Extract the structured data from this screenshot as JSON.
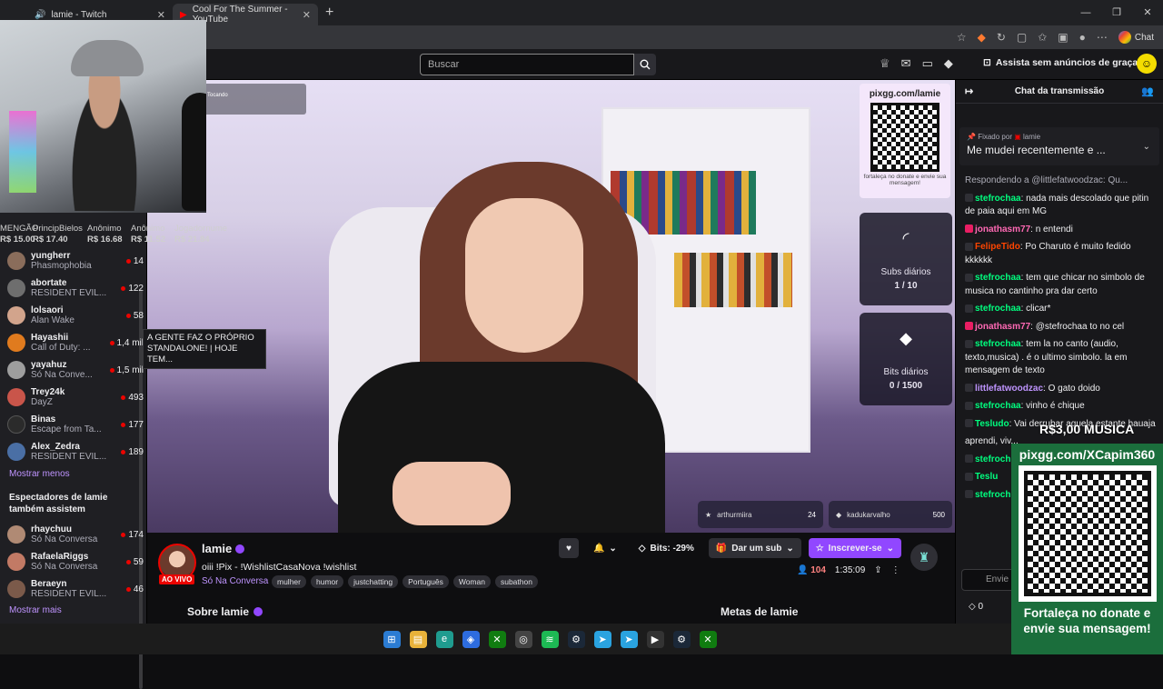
{
  "browser": {
    "tabs": [
      {
        "label": "lamie - Twitch",
        "active": true
      },
      {
        "label": "Cool For The Summer - YouTube",
        "active": false
      }
    ],
    "new_tab": "+",
    "chat_button": "Chat"
  },
  "nav": {
    "search_placeholder": "Buscar",
    "adfree_label": "Assista sem anúncios de graça"
  },
  "webcam_label": "Tocando",
  "donors": [
    {
      "name": "MENGÃO",
      "value": "R$ 15.00"
    },
    {
      "name": "PrincipBielos",
      "value": "R$ 17.40"
    },
    {
      "name": "Anônimo",
      "value": "R$ 16.68"
    },
    {
      "name": "Anônimo",
      "value": "R$ 11.52"
    },
    {
      "name": "Jogadornume",
      "value": "R$ 21.84"
    }
  ],
  "sidebar": {
    "channels": [
      {
        "name": "yungherr",
        "game": "Phasmophobia",
        "viewers": "14",
        "color": "#8a6d5b"
      },
      {
        "name": "abortate",
        "game": "RESIDENT EVIL...",
        "viewers": "122",
        "color": "#6e6e6e"
      },
      {
        "name": "lolsaori",
        "game": "Alan Wake",
        "viewers": "58",
        "color": "#d2a48c"
      },
      {
        "name": "Hayashii",
        "game": "Call of Duty: ...",
        "viewers": "1,4 mil",
        "color": "#e07b1e"
      },
      {
        "name": "yayahuz",
        "game": "Só Na Conve...",
        "viewers": "1,5 mil",
        "color": "#9e9e9e"
      },
      {
        "name": "Trey24k",
        "game": "DayZ",
        "viewers": "493",
        "color": "#c9554a"
      },
      {
        "name": "Binas",
        "game": "Escape from Ta...",
        "viewers": "177",
        "color": "#2b2b2b"
      },
      {
        "name": "Alex_Zedra",
        "game": "RESIDENT EVIL...",
        "viewers": "189",
        "color": "#4a6fa5"
      }
    ],
    "show_less": "Mostrar menos",
    "also_watch_heading": "Espectadores de lamie também assistem",
    "also_watch": [
      {
        "name": "rhaychuu",
        "game": "Só Na Conversa",
        "viewers": "174",
        "color": "#b08a74"
      },
      {
        "name": "RafaelaRiggs",
        "game": "Só Na Conversa",
        "viewers": "59",
        "color": "#c27a65"
      },
      {
        "name": "Beraeyn",
        "game": "RESIDENT EVIL...",
        "viewers": "46",
        "color": "#7b5a4a"
      }
    ],
    "show_more": "Mostrar mais",
    "tooltip": "A GENTE FAZ O PRÓPRIO STANDALONE! | HOJE TEM..."
  },
  "video": {
    "qr_url": "pixgg.com/lamie",
    "qr_caption": "fortaleça no donate e envie sua mensagem!",
    "subs_goal": {
      "label": "Subs diários",
      "value": "1 / 10"
    },
    "bits_goal": {
      "label": "Bits diários",
      "value": "0 / 1500"
    },
    "alerts": [
      {
        "user": "arthurmiira",
        "count": "24"
      },
      {
        "user": "kadukarvalho",
        "count": "500"
      }
    ]
  },
  "stream": {
    "streamer": "lamie",
    "live_badge": "AO VIVO",
    "title": "oiii !Pix - !WishlistCasaNova !wishlist",
    "category": "Só Na Conversa",
    "tags": [
      "mulher",
      "humor",
      "justchatting",
      "Português",
      "Woman",
      "subathon"
    ],
    "bits_btn": "Bits: -29%",
    "gift_btn": "Dar um sub",
    "sub_btn": "Inscrever-se",
    "viewers": "104",
    "uptime": "1:35:09",
    "about": "Sobre lamie",
    "goals": "Metas de lamie"
  },
  "chat": {
    "header": "Chat da transmissão",
    "pinned_by": "Fixado por",
    "pinned_by_user": "lamie",
    "pinned_message": "Me mudei recentemente e ...",
    "messages": [
      {
        "user": "",
        "text": "Respondendo a @littlefatwoodzac: Qu...",
        "color": "#adadb8",
        "reply": true
      },
      {
        "user": "stefrochaa",
        "text": ": nada mais descolado que pitin de paia aqui em MG",
        "color": "#00ff7f"
      },
      {
        "user": "jonathasm77",
        "text": ": n entendi",
        "color": "#ff69b4"
      },
      {
        "user": "FelipeTido",
        "text": ": Po Charuto é muito fedido kkkkkk",
        "color": "#ff4500"
      },
      {
        "user": "stefrochaa",
        "text": ": tem que chicar no simbolo de musica no cantinho pra dar certo",
        "color": "#00ff7f"
      },
      {
        "user": "stefrochaa",
        "text": ": clicar*",
        "color": "#00ff7f"
      },
      {
        "user": "jonathasm77",
        "text": ": @stefrochaa to no cel",
        "color": "#ff69b4"
      },
      {
        "user": "stefrochaa",
        "text": ": tem la no canto (audio, texto,musica) . é o ultimo simbolo. la em mensagem de texto",
        "color": "#00ff7f"
      },
      {
        "user": "littlefatwoodzac",
        "text": ": O gato doido",
        "color": "#bf94ff"
      },
      {
        "user": "stefrochaa",
        "text": ": vinho é chique",
        "color": "#00ff7f"
      },
      {
        "user": "Tesludo",
        "text": ": Vai derrubar aquela estante hauaja",
        "color": "#00ff7f"
      },
      {
        "user": "",
        "text": "aprendi, viv...",
        "color": "#efeff1"
      },
      {
        "user": "stefroch",
        "text": "",
        "color": "#00ff7f"
      },
      {
        "user": "Teslu",
        "text": "",
        "color": "#00ff7f"
      },
      {
        "user": "stefroch",
        "text": "",
        "color": "#00ff7f"
      }
    ],
    "input_placeholder": "Envie",
    "points": "0"
  },
  "overlay": {
    "music": "R$3,00 MUSICA",
    "donate_url": "pixgg.com/XCapim360",
    "donate_caption": "Fortaleça no donate e envie sua mensagem!"
  }
}
